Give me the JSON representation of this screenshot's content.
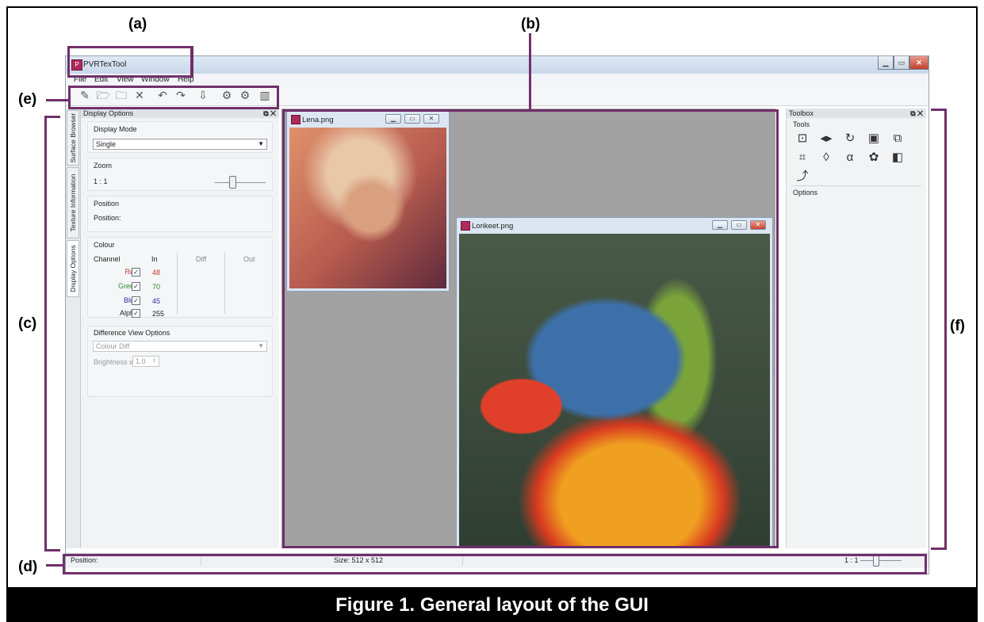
{
  "annotations": {
    "a": "(a)",
    "b": "(b)",
    "c": "(c)",
    "d": "(d)",
    "e": "(e)",
    "f": "(f)"
  },
  "caption": "Figure 1. General layout of the GUI",
  "app": {
    "title": "PVRTexTool",
    "menu": [
      "File",
      "Edit",
      "View",
      "Window",
      "Help"
    ],
    "toolbar_icons": [
      "new-icon",
      "open-icon",
      "open-folder-icon",
      "close-icon",
      "undo-icon",
      "redo-icon",
      "export-icon",
      "encode-icon",
      "decode-icon",
      "statistics-icon"
    ]
  },
  "side_tabs": [
    "Surface Browser",
    "Texture Information",
    "Display Options"
  ],
  "display_options": {
    "title": "Display Options",
    "display_mode_label": "Display Mode",
    "display_mode_value": "Single",
    "zoom_label": "Zoom",
    "zoom_value": "1 : 1",
    "position_label": "Position",
    "position_text": "Position:",
    "colour_label": "Colour",
    "headers": {
      "channel": "Channel",
      "in": "In",
      "diff": "Diff",
      "out": "Out"
    },
    "channels": [
      {
        "name": "Red",
        "in": "48",
        "color": "#c0392b"
      },
      {
        "name": "Green",
        "in": "70",
        "color": "#2e8b2e"
      },
      {
        "name": "Blue",
        "in": "45",
        "color": "#2a2aa0"
      },
      {
        "name": "Alpha",
        "in": "255",
        "color": "#222222"
      }
    ],
    "diff_view_label": "Difference View Options",
    "diff_mode_value": "Colour Diff",
    "brightness_label": "Brightness x",
    "brightness_value": "1.0"
  },
  "doc_windows": [
    {
      "title": "Lena.png"
    },
    {
      "title": "Lorikeet.png"
    }
  ],
  "toolbox": {
    "title": "Toolbox",
    "tools_label": "Tools",
    "options_label": "Options",
    "tools": [
      "resize-icon",
      "flip-icon",
      "rotate-icon",
      "border-icon",
      "mipmap-icon",
      "crop-icon",
      "premultiply-icon",
      "alpha-icon",
      "palette-icon",
      "layer-icon",
      "normal-map-icon"
    ]
  },
  "status": {
    "position": "Position:",
    "size": "Size: 512 x 512",
    "zoom": "1 : 1"
  },
  "colors": {
    "highlight": "#702f6b",
    "caption_bg": "#000000",
    "mdi_bg": "#a2a2a2"
  }
}
